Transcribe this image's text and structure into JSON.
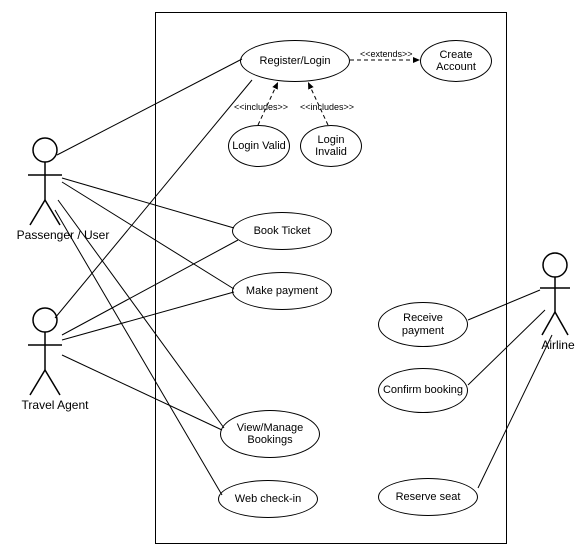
{
  "chart_data": {
    "type": "use-case-diagram",
    "actors": [
      {
        "id": "passenger",
        "label": "Passenger / User"
      },
      {
        "id": "travelagent",
        "label": "Travel Agent"
      },
      {
        "id": "airline",
        "label": "Airline"
      }
    ],
    "usecases": [
      {
        "id": "register",
        "label": "Register/Login"
      },
      {
        "id": "createacct",
        "label": "Create Account"
      },
      {
        "id": "loginvalid",
        "label": "Login Valid"
      },
      {
        "id": "logininvalid",
        "label": "Login Invalid"
      },
      {
        "id": "bookticket",
        "label": "Book Ticket"
      },
      {
        "id": "makepayment",
        "label": "Make payment"
      },
      {
        "id": "receivepayment",
        "label": "Receive payment"
      },
      {
        "id": "confirmbooking",
        "label": "Confirm booking"
      },
      {
        "id": "viewmanage",
        "label": "View/Manage Bookings"
      },
      {
        "id": "webcheckin",
        "label": "Web check-in"
      },
      {
        "id": "reserveseat",
        "label": "Reserve seat"
      }
    ],
    "relationships": [
      {
        "from": "passenger",
        "to": "register",
        "type": "association"
      },
      {
        "from": "passenger",
        "to": "bookticket",
        "type": "association"
      },
      {
        "from": "passenger",
        "to": "makepayment",
        "type": "association"
      },
      {
        "from": "passenger",
        "to": "viewmanage",
        "type": "association"
      },
      {
        "from": "passenger",
        "to": "webcheckin",
        "type": "association"
      },
      {
        "from": "travelagent",
        "to": "register",
        "type": "association"
      },
      {
        "from": "travelagent",
        "to": "bookticket",
        "type": "association"
      },
      {
        "from": "travelagent",
        "to": "makepayment",
        "type": "association"
      },
      {
        "from": "travelagent",
        "to": "viewmanage",
        "type": "association"
      },
      {
        "from": "airline",
        "to": "receivepayment",
        "type": "association"
      },
      {
        "from": "airline",
        "to": "confirmbooking",
        "type": "association"
      },
      {
        "from": "airline",
        "to": "reserveseat",
        "type": "association"
      },
      {
        "from": "register",
        "to": "createacct",
        "type": "extend",
        "label": "<<extends>>"
      },
      {
        "from": "loginvalid",
        "to": "register",
        "type": "include",
        "label": "<<includes>>"
      },
      {
        "from": "logininvalid",
        "to": "register",
        "type": "include",
        "label": "<<includes>>"
      }
    ],
    "rel_labels": {
      "extends": "<<extends>>",
      "includes1": "<<includes>>",
      "includes2": "<<includes>>"
    }
  }
}
